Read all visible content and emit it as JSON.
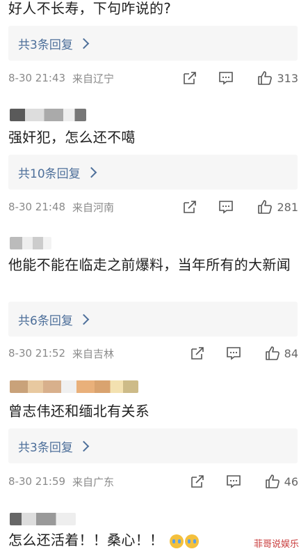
{
  "comments": [
    {
      "content": "好人不长寿，下句咋说的?",
      "replies_label": "共3条回复",
      "time": "8-30 21:43",
      "location": "来自辽宁",
      "likes": "313"
    },
    {
      "content": "强奸犯，怎么还不噶",
      "replies_label": "共10条回复",
      "time": "8-30 21:48",
      "location": "来自河南",
      "likes": "281"
    },
    {
      "content": "他能不能在临走之前爆料，当年所有的大新闻",
      "replies_label": "共6条回复",
      "time": "8-30 21:52",
      "location": "来自吉林",
      "likes": "84"
    },
    {
      "content": "曾志伟还和缅北有关系",
      "replies_label": "共3条回复",
      "time": "8-30 21:59",
      "location": "来自广东",
      "likes": "46"
    },
    {
      "content": "怎么还活着！！桑心！！"
    }
  ],
  "watermark": "菲哥说娱乐"
}
